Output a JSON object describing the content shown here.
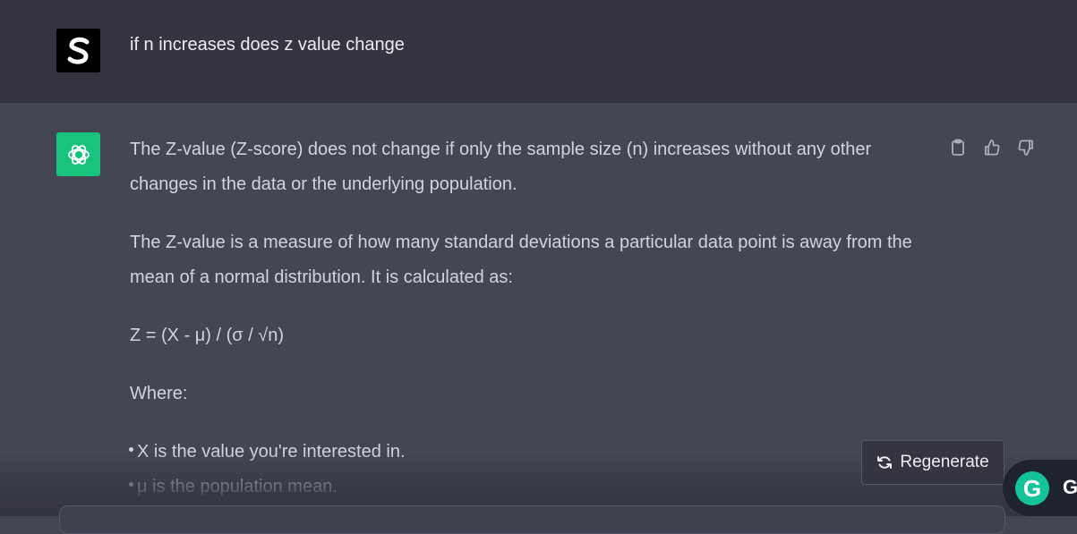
{
  "user_message": {
    "text": "if n increases does z value change",
    "avatar_icon": "user-s-logo"
  },
  "assistant_message": {
    "avatar_icon": "openai-logo",
    "avatar_color": "#19c37d",
    "paragraphs": [
      "The Z-value (Z-score) does not change if only the sample size (n) increases without any other changes in the data or the underlying population.",
      "The Z-value is a measure of how many standard deviations a particular data point is away from the mean of a normal distribution. It is calculated as:",
      "Z = (X - μ) / (σ / √n)",
      "Where:"
    ],
    "bullets": [
      "X is the value you're interested in.",
      "μ is the population mean."
    ]
  },
  "actions": {
    "copy_icon": "clipboard-icon",
    "like_icon": "thumbs-up-icon",
    "dislike_icon": "thumbs-down-icon"
  },
  "regenerate": {
    "label": "Regenerate",
    "icon": "refresh-icon"
  },
  "grammarly": {
    "icon_letter": "G",
    "trailing_letter": "G",
    "color": "#15c39a"
  }
}
